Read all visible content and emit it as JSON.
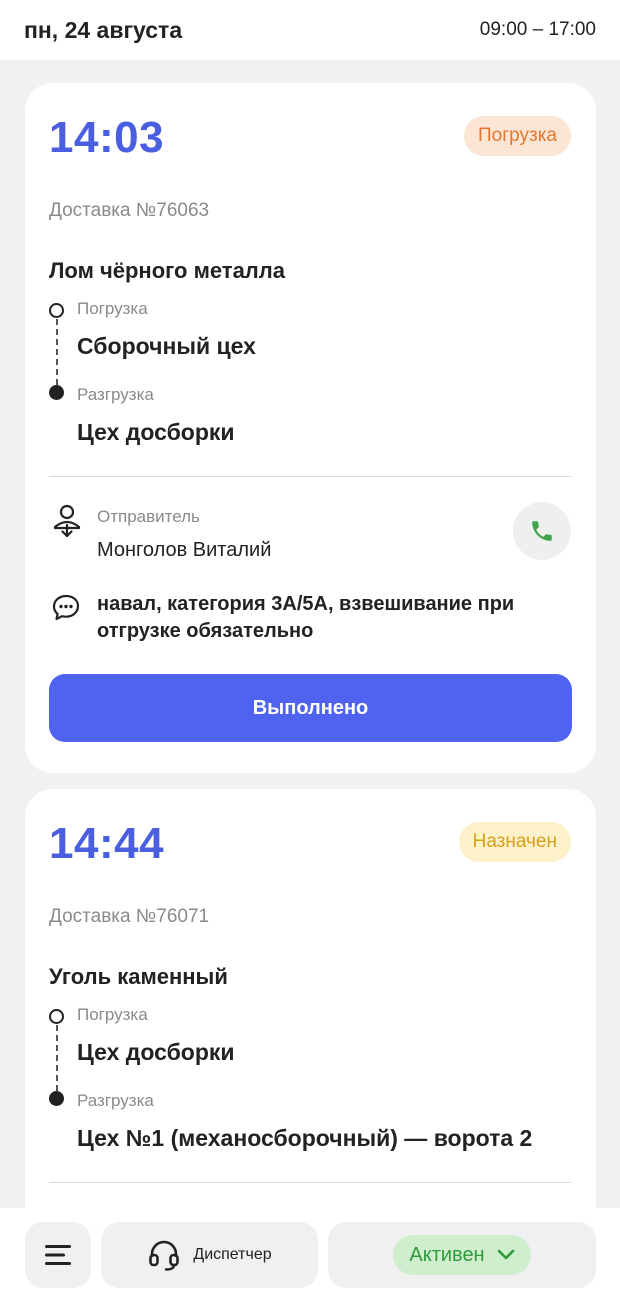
{
  "header": {
    "date": "пн, 24 августа",
    "hours": "09:00 – 17:00"
  },
  "deliveries": [
    {
      "time": "14:03",
      "status": "Погрузка",
      "number": "Доставка №76063",
      "cargo": "Лом чёрного металла",
      "loading_label": "Погрузка",
      "loading_place": "Сборочный цех",
      "unloading_label": "Разгрузка",
      "unloading_place": "Цех досборки",
      "sender_label": "Отправитель",
      "sender_name": "Монголов Виталий",
      "comment": "навал, категория 3А/5А, взвешивание при отгрузке обязательно",
      "done_label": "Выполнено"
    },
    {
      "time": "14:44",
      "status": "Назначен",
      "number": "Доставка №76071",
      "cargo": "Уголь каменный",
      "loading_label": "Погрузка",
      "loading_place": "Цех досборки",
      "unloading_label": "Разгрузка",
      "unloading_place": "Цех №1 (механосборочный) — ворота 2"
    }
  ],
  "bottom_bar": {
    "dispatcher_label": "Диспетчер",
    "status_label": "Активен"
  },
  "colors": {
    "accent": "#4f63f0",
    "time": "#4a5fe0",
    "status_loading": "#e2782e",
    "status_assigned": "#d6a11a",
    "status_active": "#2f9a3c",
    "phone": "#3fa44a"
  },
  "icons": {
    "menu": "menu-icon",
    "headset": "headset-icon",
    "chevron": "chevron-down-icon",
    "sender": "sender-icon",
    "comment": "comment-icon",
    "phone": "phone-icon"
  }
}
